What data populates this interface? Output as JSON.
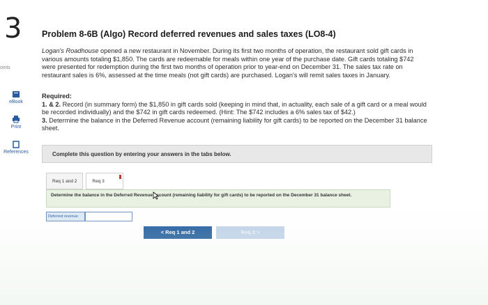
{
  "question_number": "3",
  "sidebar": {
    "points_label": "oints",
    "items": [
      {
        "label": "eBook",
        "icon": "book-icon"
      },
      {
        "label": "Print",
        "icon": "printer-icon"
      },
      {
        "label": "References",
        "icon": "references-icon"
      }
    ]
  },
  "problem": {
    "title": "Problem 8-6B (Algo) Record deferred revenues and sales taxes (LO8-4)",
    "company": "Logan's Roadhouse",
    "intro": "opened a new restaurant in November. During its first two months of operation, the restaurant sold gift cards in various amounts totaling $1,850. The cards are redeemable for meals within one year of the purchase date. Gift cards totaling $742 were presented for redemption during the first two months of operation prior to year-end on December 31. The sales tax rate on restaurant sales is 6%, assessed at the time meals (not gift cards) are purchased. Logan's will remit sales taxes in January.",
    "required_label": "Required:",
    "req1_num": "1. & 2.",
    "req1": "Record (in summary form) the $1,850 in gift cards sold (keeping in mind that, in actuality, each sale of a gift card or a meal would be recorded individually) and the $742 in gift cards redeemed. (Hint: The $742 includes a 6% sales tax of $42.)",
    "req3_num": "3.",
    "req3": "Determine the balance in the Deferred Revenue account (remaining liability for gift cards) to be reported on the December 31 balance sheet."
  },
  "instructions": "Complete this question by entering your answers in the tabs below.",
  "tabs": [
    {
      "label": "Req 1 and 2",
      "active": false
    },
    {
      "label": "Req 3",
      "active": true
    }
  ],
  "task": "Determine the balance in the Deferred Revenue account (remaining liability for gift cards) to be reported on the December 31 balance sheet.",
  "answer": {
    "label": "Deferred revenue",
    "value": ""
  },
  "nav": {
    "prev_label": "< Req 1 and 2",
    "next_label": "Req 3 >"
  },
  "colors": {
    "accent": "#1f5a9c",
    "task_bg": "#e9f1e3"
  }
}
